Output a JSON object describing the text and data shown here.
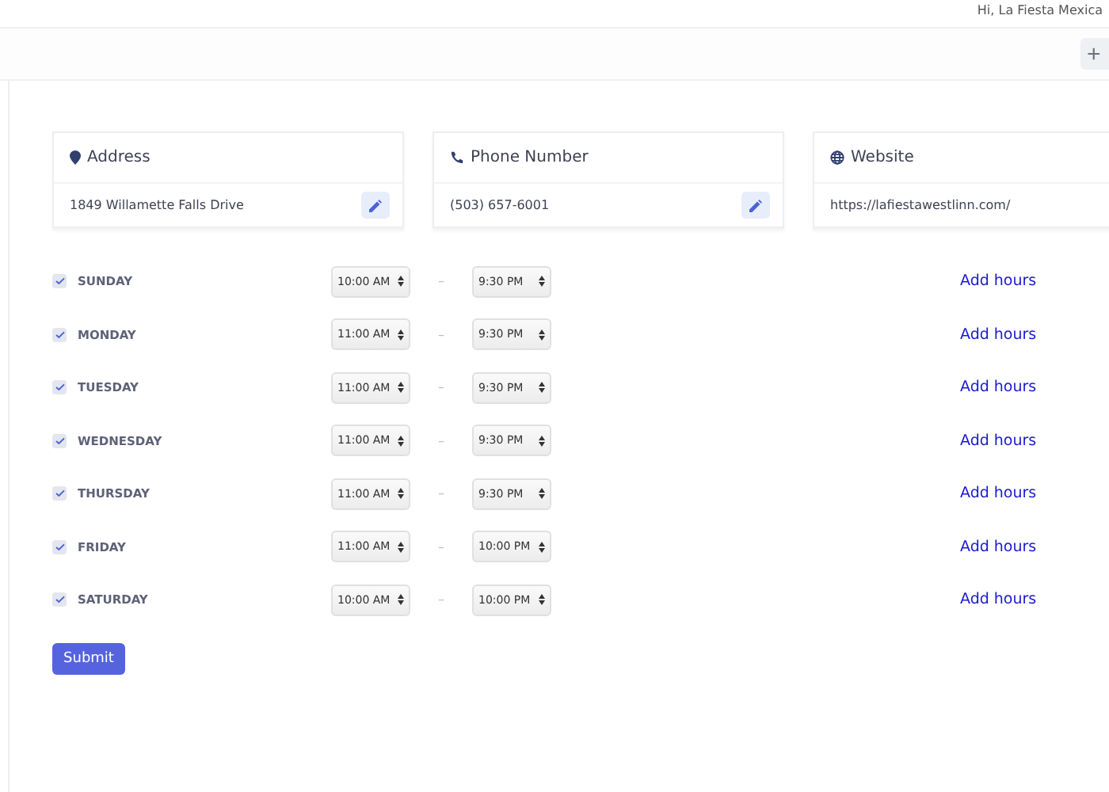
{
  "header": {
    "greeting": "Hi, La Fiesta Mexica"
  },
  "toolbar": {
    "add_button": "+"
  },
  "info_cards": [
    {
      "kind": "address",
      "title": "Address",
      "value": "1849 Willamette Falls Drive"
    },
    {
      "kind": "phone",
      "title": "Phone Number",
      "value": "(503) 657-6001"
    },
    {
      "kind": "website",
      "title": "Website",
      "value": "https://lafiestawestlinn.com/"
    }
  ],
  "separator": "–",
  "hours": [
    {
      "day": "SUNDAY",
      "checked": true,
      "open": "10:00 AM",
      "close": "9:30 PM",
      "action": "Add hours"
    },
    {
      "day": "MONDAY",
      "checked": true,
      "open": "11:00 AM",
      "close": "9:30 PM",
      "action": "Add hours"
    },
    {
      "day": "TUESDAY",
      "checked": true,
      "open": "11:00 AM",
      "close": "9:30 PM",
      "action": "Add hours"
    },
    {
      "day": "WEDNESDAY",
      "checked": true,
      "open": "11:00 AM",
      "close": "9:30 PM",
      "action": "Add hours"
    },
    {
      "day": "THURSDAY",
      "checked": true,
      "open": "11:00 AM",
      "close": "9:30 PM",
      "action": "Add hours"
    },
    {
      "day": "FRIDAY",
      "checked": true,
      "open": "11:00 AM",
      "close": "10:00 PM",
      "action": "Add hours"
    },
    {
      "day": "SATURDAY",
      "checked": true,
      "open": "10:00 AM",
      "close": "10:00 PM",
      "action": "Add hours"
    }
  ],
  "submit": "Submit"
}
